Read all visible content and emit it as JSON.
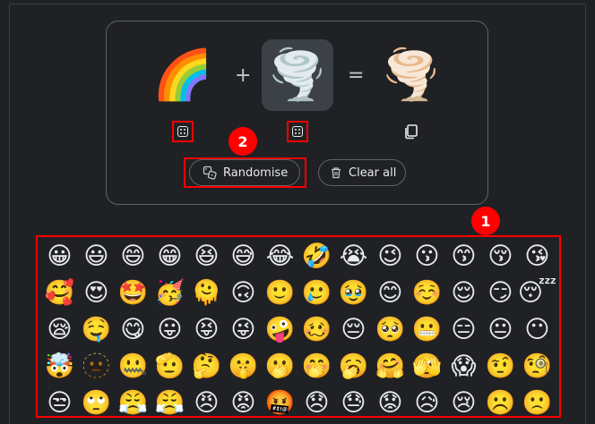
{
  "mixer": {
    "left_emoji": "🌈",
    "middle_emoji": "🌪️",
    "result_emoji": "🌪️",
    "plus": "+",
    "equals": "=",
    "randomise_label": "Randomise",
    "clear_label": "Clear all"
  },
  "annotations": {
    "badge_1": "1",
    "badge_2": "2",
    "highlight_color": "#ff0000"
  },
  "emoji_grid": [
    [
      "😀",
      "😃",
      "😄",
      "😁",
      "😆",
      "😅",
      "😂",
      "🤣",
      "😭",
      "😉",
      "😗",
      "😙",
      "😚",
      "😘"
    ],
    [
      "🥰",
      "😍",
      "🤩",
      "🥳",
      "🫠",
      "🙃",
      "🙂",
      "🥲",
      "🥹",
      "😊",
      "☺️",
      "😌",
      "😏",
      "😴"
    ],
    [
      "😪",
      "🤤",
      "😋",
      "😛",
      "😝",
      "😜",
      "🤪",
      "🥴",
      "😔",
      "🥺",
      "😬",
      "😑",
      "😐",
      "😶"
    ],
    [
      "🤯",
      "🫥",
      "🤐",
      "🫡",
      "🤔",
      "🤫",
      "🫢",
      "🤭",
      "🥱",
      "🤗",
      "🫣",
      "😱",
      "🤨",
      "🧐"
    ],
    [
      "😒",
      "🙄",
      "😤",
      "😤",
      "😠",
      "😡",
      "🤬",
      "😞",
      "😓",
      "😟",
      "😥",
      "😢",
      "☹️",
      "🙁"
    ]
  ]
}
